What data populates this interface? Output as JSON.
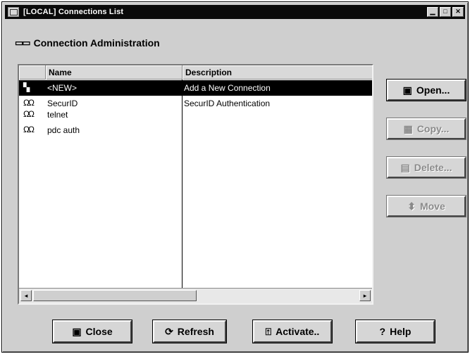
{
  "window": {
    "title": "[LOCAL] Connections List",
    "min_glyph": "▁",
    "max_glyph": "□",
    "close_glyph": "✕"
  },
  "header": {
    "icon": "▭▭",
    "title": "Connection Administration"
  },
  "list": {
    "columns": {
      "name": "Name",
      "description": "Description"
    },
    "rows": [
      {
        "icon": "▚",
        "name": "<NEW>",
        "description": "Add a New Connection",
        "selected": true
      },
      {
        "icon": "ΩΩ",
        "name": "SecurID",
        "description": "SecurID Authentication",
        "selected": false
      },
      {
        "icon": "ΩΩ",
        "name": "telnet",
        "description": "",
        "selected": false
      },
      {
        "icon": "ΩΩ",
        "name": "pdc auth",
        "description": "",
        "selected": false
      }
    ],
    "scroll_left": "◂",
    "scroll_right": "▸"
  },
  "side_buttons": {
    "open": {
      "icon": "▣",
      "label": "Open..."
    },
    "copy": {
      "icon": "▦",
      "label": "Copy..."
    },
    "delete": {
      "icon": "▤",
      "label": "Delete..."
    },
    "move": {
      "icon": "⬍",
      "label": "Move"
    }
  },
  "bottom_buttons": {
    "close": {
      "icon": "▣",
      "label": "Close"
    },
    "refresh": {
      "icon": "⟳",
      "label": "Refresh"
    },
    "activate": {
      "icon": "⍐",
      "label": "Activate.."
    },
    "help": {
      "icon": "?",
      "label": "Help"
    }
  },
  "colors": {
    "window_bg": "#cfcfcf",
    "titlebar_bg": "#0a0a0a",
    "selection_bg": "#000000",
    "disabled_text": "#8a8a8a"
  }
}
